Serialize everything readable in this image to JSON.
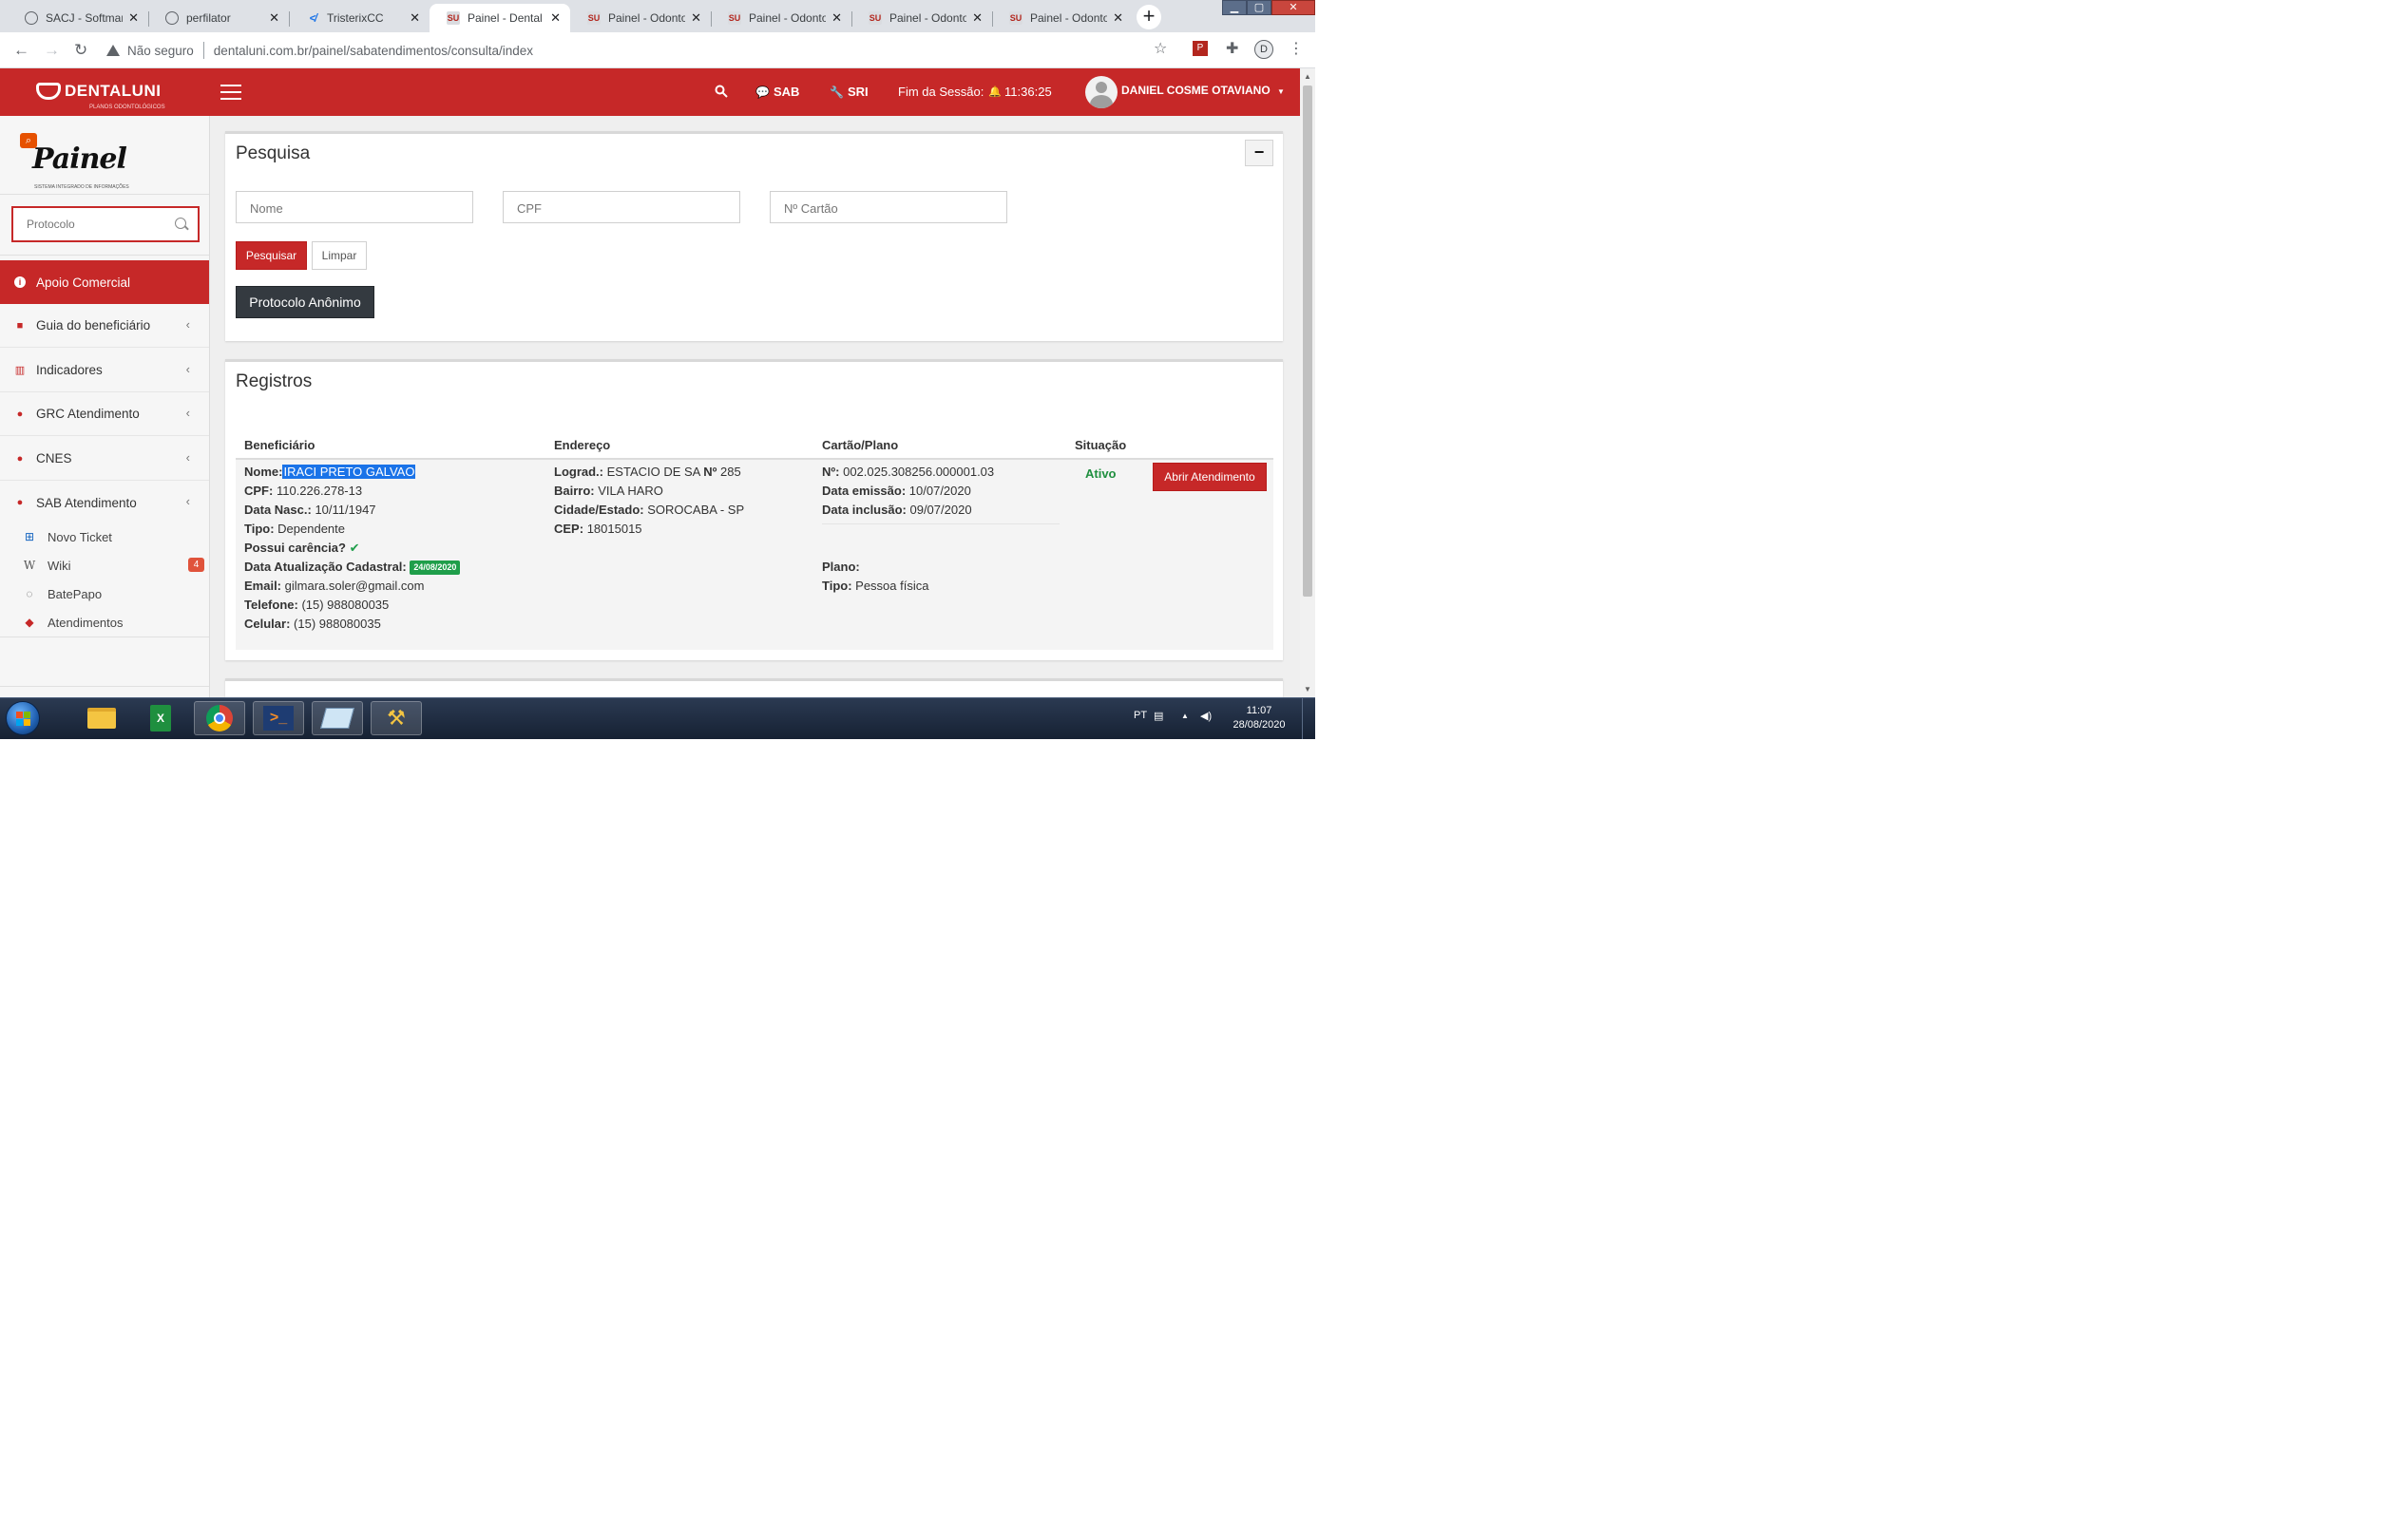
{
  "browser": {
    "tabs": [
      {
        "title": "SACJ - Softmar",
        "icon": "globe-icon"
      },
      {
        "title": "perfilator",
        "icon": "globe-icon"
      },
      {
        "title": "TristerixCC",
        "icon": "tristerix-icon"
      },
      {
        "title": "Painel - Dental",
        "icon": "odonto-icon",
        "active": true
      },
      {
        "title": "Painel - Odonto",
        "icon": "odonto-icon"
      },
      {
        "title": "Painel - Odonto",
        "icon": "odonto-icon"
      },
      {
        "title": "Painel - Odonto",
        "icon": "odonto-icon"
      },
      {
        "title": "Painel - Odonto",
        "icon": "odonto-icon"
      }
    ],
    "security_label": "Não seguro",
    "url": "dentaluni.com.br/painel/sabatendimentos/consulta/index",
    "profile_initial": "D"
  },
  "header": {
    "logo_text": "DENTALUNI",
    "logo_sub": "PLANOS ODONTOLÓGICOS",
    "sab_label": "SAB",
    "sri_label": "SRI",
    "session_label": "Fim da Sessão:",
    "session_time": "11:36:25",
    "user_name": "DANIEL COSME OTAVIANO"
  },
  "sidebar": {
    "brand_title": "Painel",
    "brand_sub": "SISTEMA INTEGRADO DE INFORMAÇÕES",
    "protocol_placeholder": "Protocolo",
    "menu": [
      {
        "label": "Apoio Comercial",
        "icon": "info-icon",
        "active": true
      },
      {
        "label": "Guia do beneficiário",
        "icon": "book-icon"
      },
      {
        "label": "Indicadores",
        "icon": "bar-chart-icon"
      },
      {
        "label": "GRC Atendimento",
        "icon": "chat-icon"
      },
      {
        "label": "CNES",
        "icon": "chat-icon"
      },
      {
        "label": "SAB Atendimento",
        "icon": "chat-icon"
      }
    ],
    "submenu": [
      {
        "label": "Novo Ticket",
        "icon": "plus-square-icon"
      },
      {
        "label": "Wiki",
        "icon": "wikipedia-icon",
        "badge": "4"
      },
      {
        "label": "BatePapo",
        "icon": "comments-icon"
      },
      {
        "label": "Atendimentos",
        "icon": "ticket-icon"
      }
    ]
  },
  "search": {
    "title": "Pesquisa",
    "collapse_label": "−",
    "name_placeholder": "Nome",
    "cpf_placeholder": "CPF",
    "card_placeholder": "Nº Cartão",
    "search_button": "Pesquisar",
    "clear_button": "Limpar",
    "anon_button": "Protocolo Anônimo"
  },
  "records": {
    "title": "Registros",
    "columns": [
      "Beneficiário",
      "Endereço",
      "Cartão/Plano",
      "Situação"
    ],
    "row": {
      "nome_label": "Nome:",
      "nome": "IRACI PRETO GALVAO",
      "cpf_label": "CPF:",
      "cpf": "110.226.278-13",
      "nasc_label": "Data Nasc.:",
      "nasc": "10/11/1947",
      "tipo_label": "Tipo:",
      "tipo": "Dependente",
      "carencia_label": "Possui carência?",
      "atualizacao_label": "Data Atualização Cadastral:",
      "atualizacao": "24/08/2020",
      "email_label": "Email:",
      "email": "gilmara.soler@gmail.com",
      "telefone_label": "Telefone:",
      "telefone": "(15) 988080035",
      "celular_label": "Celular:",
      "celular": "(15) 988080035",
      "lograd_label": "Lograd.:",
      "lograd": "ESTACIO DE SA",
      "numero_label": "Nº",
      "numero": "285",
      "bairro_label": "Bairro:",
      "bairro": "VILA HARO",
      "cidade_label": "Cidade/Estado:",
      "cidade": "SOROCABA - SP",
      "cep_label": "CEP:",
      "cep": "18015015",
      "cartao_label": "Nº:",
      "cartao": "002.025.308256.000001.03",
      "emissao_label": "Data emissão:",
      "emissao": "10/07/2020",
      "inclusao_label": "Data inclusão:",
      "inclusao": "09/07/2020",
      "plano_label": "Plano:",
      "plano_tipo_label": "Tipo:",
      "plano_tipo": "Pessoa física",
      "situacao": "Ativo",
      "action_button": "Abrir Atendimento"
    }
  },
  "taskbar": {
    "language": "PT",
    "time": "11:07",
    "date": "28/08/2020"
  },
  "colors": {
    "brand_red": "#c62828",
    "status_green": "#1f8f3f",
    "highlight_blue": "#1a73e8"
  }
}
